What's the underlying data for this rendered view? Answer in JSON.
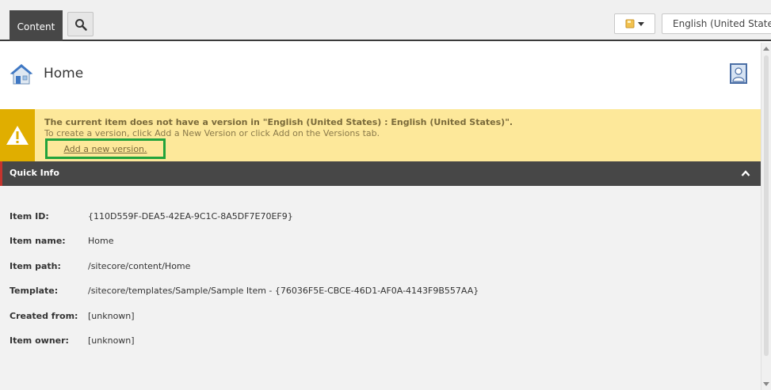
{
  "toolbar": {
    "content_tab": "Content",
    "language": "English (United States)"
  },
  "header": {
    "title": "Home"
  },
  "warning": {
    "title": "The current item does not have a version in \"English (United States) : English (United States)\".",
    "text": "To create a version, click Add a New Version or click Add on the Versions tab.",
    "link": "Add a new version."
  },
  "quick_info": {
    "title": "Quick Info",
    "rows": [
      {
        "label": "Item ID:",
        "value": "{110D559F-DEA5-42EA-9C1C-8A5DF7E70EF9}"
      },
      {
        "label": "Item name:",
        "value": "Home"
      },
      {
        "label": "Item path:",
        "value": "/sitecore/content/Home"
      },
      {
        "label": "Template:",
        "value": "/sitecore/templates/Sample/Sample Item - {76036F5E-CBCE-46D1-AF0A-4143F9B557AA}"
      },
      {
        "label": "Created from:",
        "value": "[unknown]"
      },
      {
        "label": "Item owner:",
        "value": "[unknown]"
      }
    ]
  },
  "colors": {
    "warning_bg": "#fde89a",
    "warning_icon_bg": "#e0ae00",
    "link_highlight": "#22a33b",
    "bar_dark": "#474747",
    "bar_accent": "#c6342d"
  }
}
